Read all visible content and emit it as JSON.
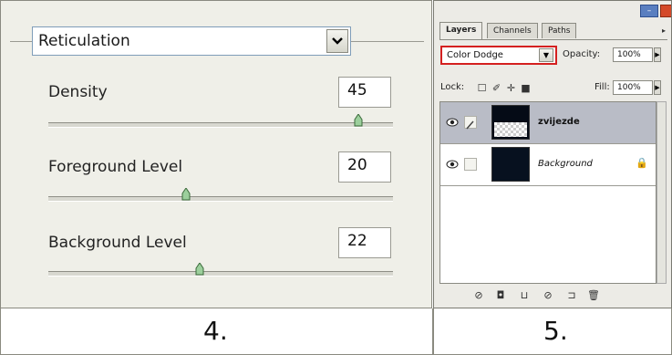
{
  "filter": {
    "selected_value": "Reticulation",
    "dropdown_icon": "chevron-down-icon"
  },
  "params": [
    {
      "label": "Density",
      "value": "45",
      "slider_fraction": 0.9
    },
    {
      "label": "Foreground Level",
      "value": "20",
      "slider_fraction": 0.4
    },
    {
      "label": "Background Level",
      "value": "22",
      "slider_fraction": 0.44
    }
  ],
  "layers_panel": {
    "tabs": [
      "Layers",
      "Channels",
      "Paths"
    ],
    "active_tab": "Layers",
    "blend_mode": "Color Dodge",
    "opacity_label": "Opacity:",
    "opacity_value": "100%",
    "lock_label": "Lock:",
    "fill_label": "Fill:",
    "fill_value": "100%",
    "layers": [
      {
        "name": "zvijezde",
        "selected": true,
        "thumbnail": "black-with-checker-mask"
      },
      {
        "name": "Background",
        "selected": false,
        "locked": true,
        "thumbnail": "dark-navy"
      }
    ],
    "highlight_color": "#d42020"
  },
  "captions": {
    "left": "4.",
    "right": "5."
  }
}
